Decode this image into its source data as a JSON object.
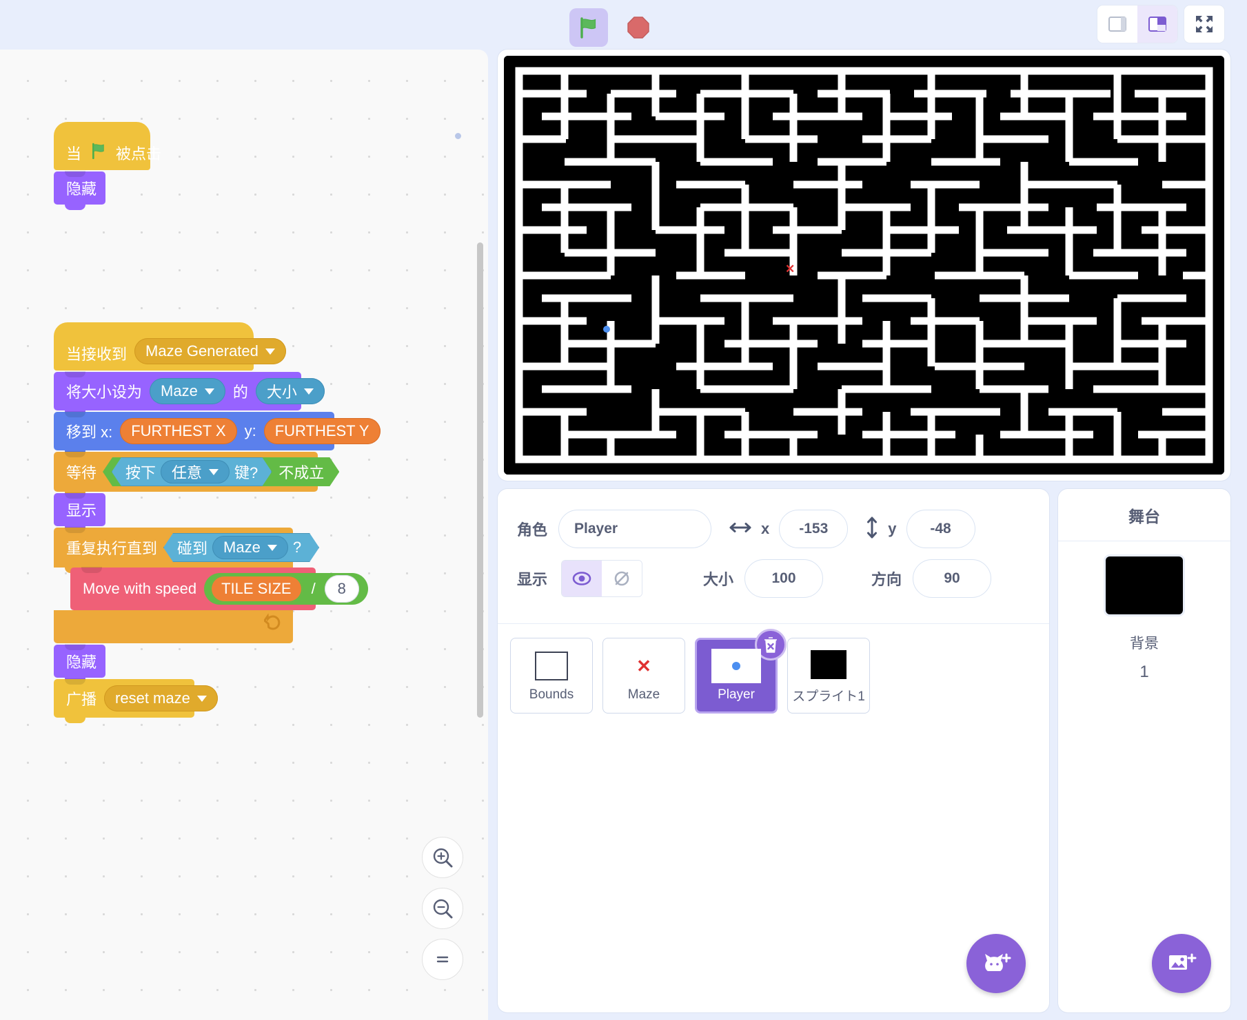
{
  "toolbar": {
    "green_flag_icon": "green-flag-icon",
    "stop_icon": "stop-sign-icon",
    "layout_small_icon": "layout-small-stage-icon",
    "layout_large_icon": "layout-large-stage-icon",
    "fullscreen_icon": "fullscreen-icon"
  },
  "code_area": {
    "zoom_in_label": "+",
    "zoom_out_label": "−",
    "zoom_reset_label": "=",
    "scripts": [
      {
        "id": "script-1",
        "blocks": [
          {
            "type": "hat",
            "category": "event",
            "parts": [
              {
                "kind": "label",
                "text": "当"
              },
              {
                "kind": "flag"
              },
              {
                "kind": "label",
                "text": "被点击"
              }
            ]
          },
          {
            "type": "stack",
            "category": "looks",
            "parts": [
              {
                "kind": "label",
                "text": "隐藏"
              }
            ]
          }
        ]
      },
      {
        "id": "script-2",
        "blocks": [
          {
            "type": "hat",
            "category": "event",
            "parts": [
              {
                "kind": "label",
                "text": "当接收到"
              },
              {
                "kind": "dropdown-event",
                "text": "Maze Generated"
              }
            ]
          },
          {
            "type": "stack",
            "category": "looks",
            "parts": [
              {
                "kind": "label",
                "text": "将大小设为"
              },
              {
                "kind": "dropdown-sense",
                "text": "Maze"
              },
              {
                "kind": "label",
                "text": "的"
              },
              {
                "kind": "dropdown-sense",
                "text": "大小"
              }
            ]
          },
          {
            "type": "stack",
            "category": "motion",
            "parts": [
              {
                "kind": "label",
                "text": "移到 x:"
              },
              {
                "kind": "var",
                "text": "FURTHEST X"
              },
              {
                "kind": "label",
                "text": "y:"
              },
              {
                "kind": "var",
                "text": "FURTHEST Y"
              }
            ]
          },
          {
            "type": "stack",
            "category": "control",
            "parts": [
              {
                "kind": "label",
                "text": "等待"
              },
              {
                "kind": "bool-not",
                "inner_prefix": "按下",
                "inner_dropdown": "任意",
                "inner_suffix": "键?",
                "not_text": "不成立"
              }
            ]
          },
          {
            "type": "stack",
            "category": "looks",
            "parts": [
              {
                "kind": "label",
                "text": "显示"
              }
            ]
          },
          {
            "type": "c-block",
            "category": "control",
            "parts": [
              {
                "kind": "label",
                "text": "重复执行直到"
              },
              {
                "kind": "bool-touch",
                "prefix": "碰到",
                "dropdown": "Maze",
                "suffix": "?"
              }
            ],
            "inner": [
              {
                "type": "stack",
                "category": "custom",
                "parts": [
                  {
                    "kind": "label",
                    "text": "Move with speed"
                  },
                  {
                    "kind": "divide",
                    "left_var": "TILE SIZE",
                    "operator": "/",
                    "right_value": "8"
                  }
                ]
              }
            ]
          },
          {
            "type": "stack",
            "category": "looks",
            "parts": [
              {
                "kind": "label",
                "text": "隐藏"
              }
            ]
          },
          {
            "type": "stack",
            "category": "event",
            "parts": [
              {
                "kind": "label",
                "text": "广播"
              },
              {
                "kind": "dropdown-event",
                "text": "reset maze"
              }
            ]
          }
        ]
      }
    ]
  },
  "stage": {
    "player_label": "player-dot",
    "target_label": "maze-target-x"
  },
  "sprite_info": {
    "name_label": "角色",
    "name_value": "Player",
    "x_letter": "x",
    "x_value": "-153",
    "y_letter": "y",
    "y_value": "-48",
    "visible_label": "显示",
    "size_label": "大小",
    "size_value": "100",
    "direction_label": "方向",
    "direction_value": "90",
    "show_icon": "eye-icon",
    "hide_icon": "eye-crossed-icon"
  },
  "sprites": [
    {
      "name": "Bounds",
      "thumb": "square-outline",
      "selected": false
    },
    {
      "name": "Maze",
      "thumb": "red-x",
      "selected": false
    },
    {
      "name": "Player",
      "thumb": "blue-dot",
      "selected": true
    },
    {
      "name": "スプライト1",
      "thumb": "black-square",
      "selected": false
    }
  ],
  "sprite_actions": {
    "delete_icon": "trash-delete-icon",
    "add_sprite_icon": "add-sprite-cat-icon"
  },
  "stage_panel": {
    "title": "舞台",
    "backdrops_label": "背景",
    "backdrops_count": "1",
    "add_backdrop_icon": "add-backdrop-image-icon"
  }
}
